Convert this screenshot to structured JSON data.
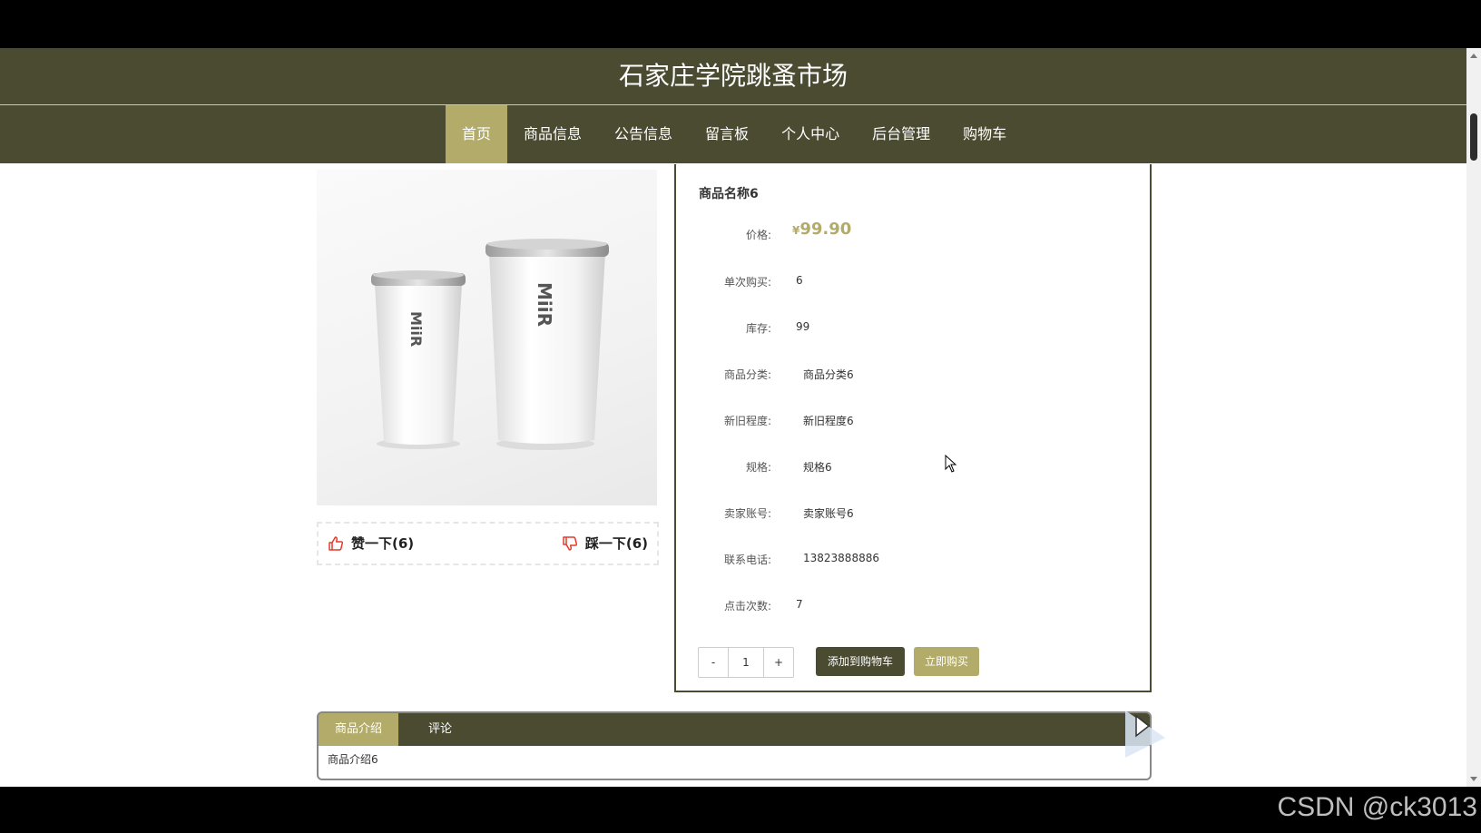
{
  "site": {
    "title": "石家庄学院跳蚤市场"
  },
  "nav": {
    "items": [
      {
        "label": "首页",
        "active": true
      },
      {
        "label": "商品信息",
        "active": false
      },
      {
        "label": "公告信息",
        "active": false
      },
      {
        "label": "留言板",
        "active": false
      },
      {
        "label": "个人中心",
        "active": false
      },
      {
        "label": "后台管理",
        "active": false
      },
      {
        "label": "购物车",
        "active": false
      }
    ]
  },
  "product": {
    "name": "商品名称6",
    "image_brand_text": "MiiR",
    "price": {
      "label": "价格:",
      "currency": "¥",
      "value": "99.90"
    },
    "single_purchase": {
      "label": "单次购买:",
      "value": "6"
    },
    "stock": {
      "label": "库存:",
      "value": "99"
    },
    "category": {
      "label": "商品分类:",
      "value": "商品分类6"
    },
    "condition": {
      "label": "新旧程度:",
      "value": "新旧程度6"
    },
    "spec": {
      "label": "规格:",
      "value": "规格6"
    },
    "seller": {
      "label": "卖家账号:",
      "value": "卖家账号6"
    },
    "phone": {
      "label": "联系电话:",
      "value": "13823888886"
    },
    "clicks": {
      "label": "点击次数:",
      "value": "7"
    }
  },
  "votes": {
    "like_label": "赞一下(6)",
    "dislike_label": "踩一下(6)"
  },
  "purchase": {
    "minus": "-",
    "quantity": "1",
    "plus": "+",
    "add_to_cart": "添加到购物车",
    "buy_now": "立即购买"
  },
  "tabs": {
    "items": [
      {
        "label": "商品介绍",
        "active": true
      },
      {
        "label": "评论",
        "active": false
      }
    ],
    "content": "商品介绍6"
  },
  "watermark": "CSDN @ck3013",
  "colors": {
    "header_bg": "#4b4b31",
    "accent": "#b2ab69"
  }
}
